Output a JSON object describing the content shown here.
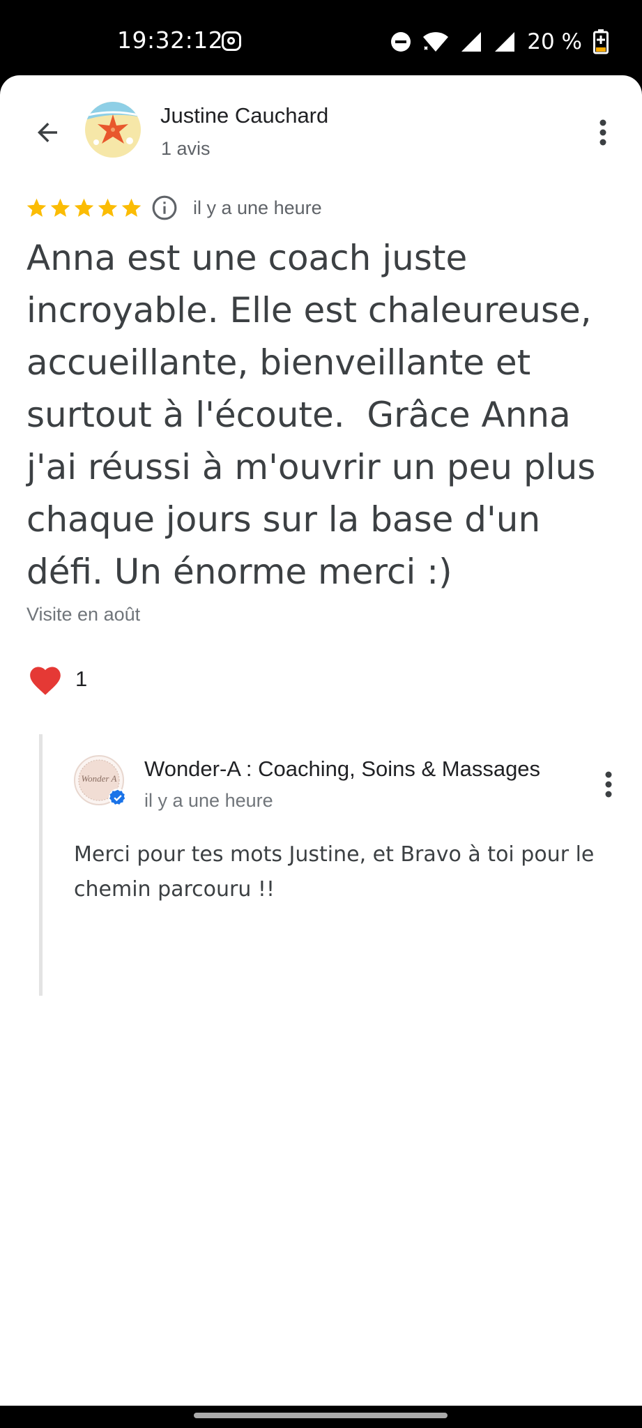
{
  "status_bar": {
    "time": "19:32:12",
    "battery": "20 %",
    "icons": [
      "instagram-icon",
      "dnd-icon",
      "wifi-icon",
      "signal-icon",
      "signal-icon",
      "battery-charging-icon"
    ]
  },
  "review": {
    "author_name": "Justine Cauchard",
    "author_meta": "1 avis",
    "rating": 5,
    "max_rating": 5,
    "time_ago": "il y a une heure",
    "text": "Anna est une coach juste incroyable. Elle est chaleureuse, accueillante, bienveillante et surtout à l'écoute.  Grâce Anna j'ai réussi à m'ouvrir un peu plus chaque jours sur la base d'un défi. Un énorme merci :)",
    "visit": "Visite en août",
    "reaction_count": "1"
  },
  "owner_reply": {
    "name": "Wonder-A : Coaching, Soins & Massages",
    "avatar_text": "Wonder A",
    "time_ago": "il y a une heure",
    "text": "Merci pour tes mots Justine, et Bravo à toi pour le chemin parcouru !!"
  },
  "colors": {
    "star": "#FBBC04",
    "heart": "#E53935",
    "verified": "#1A73E8",
    "text_primary": "#202124",
    "text_secondary": "#5F6368"
  }
}
